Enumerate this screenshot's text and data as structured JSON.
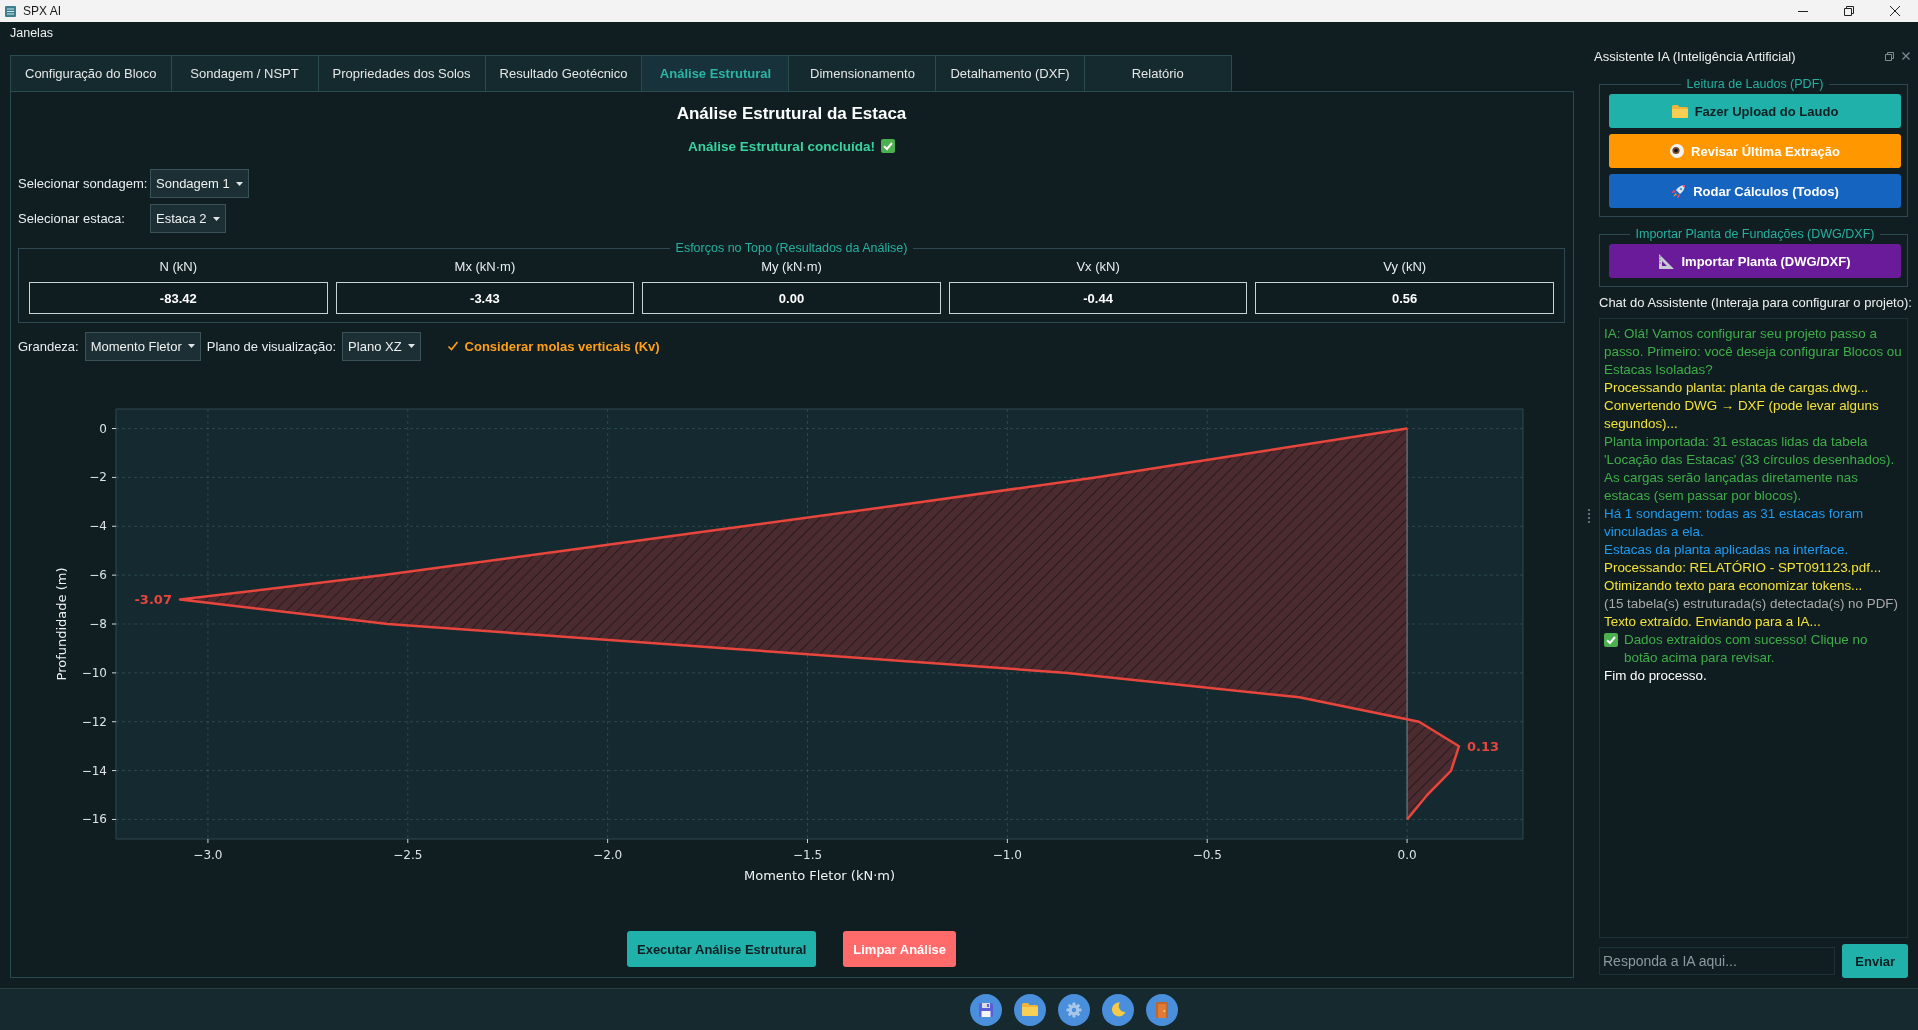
{
  "window": {
    "title": "SPX AI"
  },
  "menu": [
    "Janelas"
  ],
  "tabs": [
    {
      "label": "Configuração do Bloco",
      "selected": false
    },
    {
      "label": "Sondagem / NSPT",
      "selected": false
    },
    {
      "label": "Propriedades dos Solos",
      "selected": false
    },
    {
      "label": "Resultado Geotécnico",
      "selected": false
    },
    {
      "label": "Análise Estrutural",
      "selected": true
    },
    {
      "label": "Dimensionamento",
      "selected": false
    },
    {
      "label": "Detalhamento (DXF)",
      "selected": false
    },
    {
      "label": "Relatório",
      "selected": false
    }
  ],
  "panel": {
    "title": "Análise Estrutural da Estaca",
    "status": {
      "text": "Análise Estrutural concluída!",
      "kind": "success"
    },
    "selectors": [
      {
        "label": "Selecionar sondagem:",
        "value": "Sondagem 1"
      },
      {
        "label": "Selecionar estaca:",
        "value": "Estaca 2"
      }
    ],
    "results": {
      "title": "Esforços no Topo (Resultados da Análise)",
      "items": [
        {
          "label": "N (kN)",
          "value": "-83.42"
        },
        {
          "label": "Mx (kN·m)",
          "value": "-3.43"
        },
        {
          "label": "My (kN·m)",
          "value": "0.00"
        },
        {
          "label": "Vx (kN)",
          "value": "-0.44"
        },
        {
          "label": "Vy (kN)",
          "value": "0.56"
        }
      ]
    },
    "view_options": {
      "quantity": {
        "label": "Grandeza:",
        "value": "Momento Fletor"
      },
      "plane": {
        "label": "Plano de visualização:",
        "value": "Plano XZ"
      },
      "springs": {
        "label": "Considerar molas verticais (Kv)",
        "checked": true
      }
    },
    "chart_data": {
      "type": "area",
      "orientation": "horizontal",
      "grid": true,
      "xlabel": "Momento Fletor (kN·m)",
      "ylabel": "Profundidade (m)",
      "x": [
        0,
        -1,
        -2,
        -3,
        -4,
        -5,
        -6,
        -7,
        -8,
        -9,
        -10,
        -11,
        -12,
        -13,
        -14,
        -15,
        -16
      ],
      "series": [
        {
          "color": "#e8453c",
          "values": [
            0,
            -0.39,
            -0.78,
            -1.21,
            -1.66,
            -2.11,
            -2.56,
            -3.07,
            -2.55,
            -1.7,
            -0.85,
            -0.27,
            0.03,
            0.13,
            0.11,
            0.05,
            0
          ]
        }
      ],
      "xlim": [
        -3.23,
        0.29
      ],
      "ylim": [
        -16.8,
        0.8
      ],
      "xticks": [
        {
          "value": -3,
          "label": "−3.0"
        },
        {
          "value": -2.5,
          "label": "−2.5"
        },
        {
          "value": -2,
          "label": "−2.0"
        },
        {
          "value": -1.5,
          "label": "−1.5"
        },
        {
          "value": -1,
          "label": "−1.0"
        },
        {
          "value": -0.5,
          "label": "−0.5"
        },
        {
          "value": 0,
          "label": "0.0"
        }
      ],
      "yticks": [
        {
          "value": 0,
          "label": "0"
        },
        {
          "value": -2,
          "label": "−2"
        },
        {
          "value": -4,
          "label": "−4"
        },
        {
          "value": -6,
          "label": "−6"
        },
        {
          "value": -8,
          "label": "−8"
        },
        {
          "value": -10,
          "label": "−10"
        },
        {
          "value": -12,
          "label": "−12"
        },
        {
          "value": -14,
          "label": "−14"
        },
        {
          "value": -16,
          "label": "−16"
        }
      ],
      "annotations": [
        {
          "text": "-3.07",
          "x": -3.07,
          "y": -7
        },
        {
          "text": "0.13",
          "x": 0.13,
          "y": -13
        }
      ]
    },
    "actions": [
      {
        "label": "Executar Análise Estrutural",
        "kind": "primary"
      },
      {
        "label": "Limpar Análise",
        "kind": "danger"
      }
    ]
  },
  "assistant": {
    "title": "Assistente IA (Inteligência Artificial)",
    "groups": [
      {
        "title": "Leitura de Laudos (PDF)",
        "buttons": [
          {
            "label": "Fazer Upload do Laudo",
            "kind": "upload"
          },
          {
            "label": "Revisar Última Extração",
            "kind": "review"
          },
          {
            "label": "Rodar Cálculos (Todos)",
            "kind": "run"
          }
        ]
      },
      {
        "title": "Importar Planta de Fundações (DWG/DXF)",
        "buttons": [
          {
            "label": "Importar Planta (DWG/DXF)",
            "kind": "import"
          }
        ]
      }
    ],
    "chat_label": "Chat do Assistente (Interaja para configurar o projeto):",
    "messages": [
      {
        "text": "IA: Olá! Vamos configurar seu projeto passo a passo. Primeiro: você deseja configurar Blocos ou Estacas Isoladas?",
        "color": "#3fae49",
        "kind": "text"
      },
      {
        "text": "Processando planta: planta de cargas.dwg...",
        "color": "#f2e23a",
        "kind": "text"
      },
      {
        "text": "Convertendo DWG → DXF (pode levar alguns segundos)...",
        "color": "#f2e23a",
        "kind": "text"
      },
      {
        "text": "Planta importada: 31 estacas lidas da tabela 'Locação das Estacas' (33 círculos desenhados). As cargas serão lançadas diretamente nas estacas (sem passar por blocos).",
        "color": "#3fae49",
        "kind": "text"
      },
      {
        "text": "Há 1 sondagem: todas as 31 estacas foram vinculadas a ela.",
        "color": "#1f9bf0",
        "kind": "text"
      },
      {
        "text": "Estacas da planta aplicadas na interface.",
        "color": "#1f9bf0",
        "kind": "text"
      },
      {
        "text": "Processando: RELATÓRIO - SPT091123.pdf...",
        "color": "#f2e23a",
        "kind": "text"
      },
      {
        "text": "Otimizando texto para economizar tokens...",
        "color": "#f2e23a",
        "kind": "text"
      },
      {
        "text": "(15 tabela(s) estruturada(s) detectada(s) no PDF)",
        "color": "#a9a9a9",
        "kind": "text"
      },
      {
        "text": "Texto extraído. Enviando para a IA...",
        "color": "#f2e23a",
        "kind": "text"
      },
      {
        "text": "Dados extraídos com sucesso! Clique no botão acima para revisar.",
        "color": "#3fae49",
        "kind": "success"
      },
      {
        "text": "Fim do processo.",
        "color": "#ffffff",
        "kind": "text"
      }
    ],
    "input": {
      "placeholder": "Responda a IA aqui..."
    },
    "send": "Enviar"
  },
  "toolbar": [
    {
      "kind": "save"
    },
    {
      "kind": "open"
    },
    {
      "kind": "settings"
    },
    {
      "kind": "theme"
    },
    {
      "kind": "exit"
    }
  ]
}
